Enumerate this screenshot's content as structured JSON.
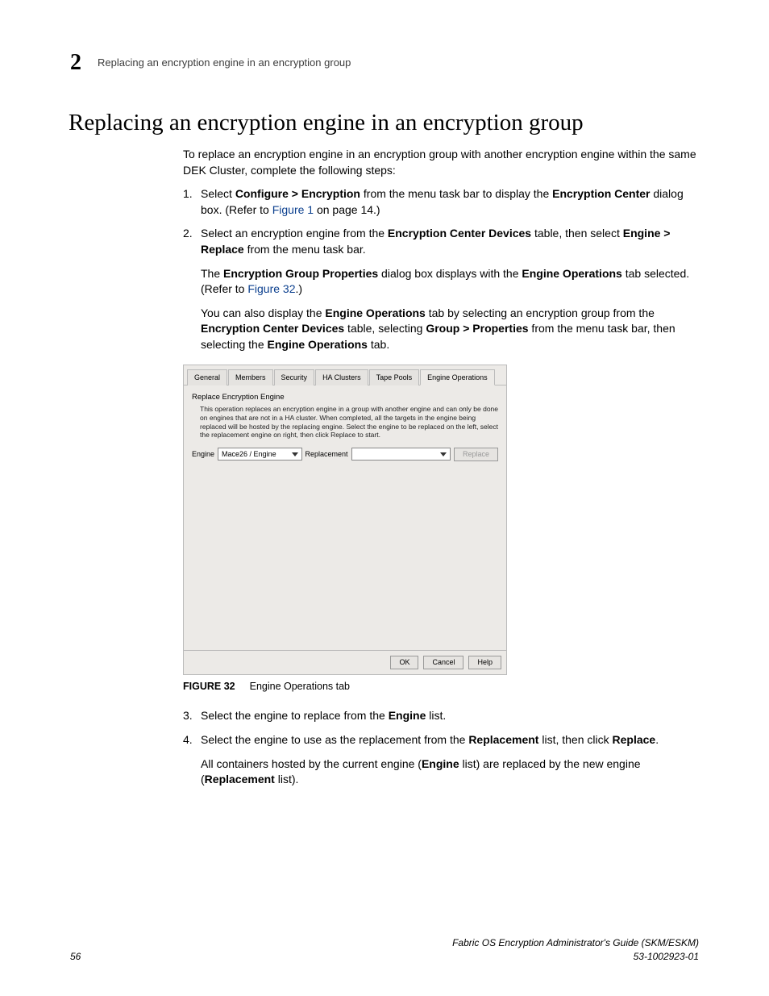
{
  "header": {
    "chapter": "2",
    "breadcrumb": "Replacing an encryption engine in an encryption group"
  },
  "title": "Replacing an encryption engine in an encryption group",
  "intro": "To replace an encryption engine in an encryption group with another encryption engine within the same DEK Cluster, complete the following steps:",
  "steps": {
    "s1": {
      "n": "1.",
      "pre": "Select ",
      "menu": "Configure > Encryption",
      "mid": " from the menu task bar to display the ",
      "ec": "Encryption Center",
      "post1": " dialog box. (Refer to ",
      "fig1": "Figure 1",
      "post2": " on page 14.)"
    },
    "s2": {
      "n": "2.",
      "pre": "Select an encryption engine from the ",
      "ecd": "Encryption Center Devices",
      "mid1": " table, then select ",
      "er": "Engine > Replace",
      "mid2": " from the menu task bar.",
      "para2_pre": "The ",
      "egp": "Encryption Group Properties",
      "para2_mid": " dialog box displays with the ",
      "eot": "Engine Operations",
      "para2_post1": " tab selected. (Refer to ",
      "fig32": "Figure 32",
      "para2_post2": ".)",
      "para3_pre": "You can also display the ",
      "para3_mid1": " tab by selecting an encryption group from the ",
      "para3_mid2": " table, selecting ",
      "gp": "Group > Properties",
      "para3_mid3": " from the menu task bar, then selecting the ",
      "para3_post": " tab."
    },
    "s3": {
      "n": "3.",
      "pre": "Select the engine to replace from the ",
      "engine": "Engine",
      "post": " list."
    },
    "s4": {
      "n": "4.",
      "pre": "Select the engine to use as the replacement from the ",
      "repl": "Replacement",
      "mid": " list, then click ",
      "replace": "Replace",
      "post": ".",
      "para2_pre": "All containers hosted by the current engine (",
      "para2_mid": " list) are replaced by the new engine (",
      "para2_post": " list)."
    }
  },
  "dialog": {
    "tabs": [
      "General",
      "Members",
      "Security",
      "HA Clusters",
      "Tape Pools",
      "Engine Operations"
    ],
    "section_title": "Replace Encryption Engine",
    "help": "This operation replaces an encryption engine in a group with another engine and can only be done on engines that are not in a HA cluster. When completed, all the targets in the engine being replaced will be hosted by the replacing engine. Select the engine to be replaced on the left, select the replacement engine on right, then click Replace to start.",
    "engine_label": "Engine",
    "engine_value": "Mace26 / Engine",
    "replacement_label": "Replacement",
    "replace_btn": "Replace",
    "ok": "OK",
    "cancel": "Cancel",
    "helpbtn": "Help"
  },
  "figure": {
    "label": "FIGURE 32",
    "caption": "Engine Operations tab"
  },
  "footer": {
    "page": "56",
    "docline1": "Fabric OS Encryption Administrator's Guide (SKM/ESKM)",
    "docline2": "53-1002923-01"
  }
}
